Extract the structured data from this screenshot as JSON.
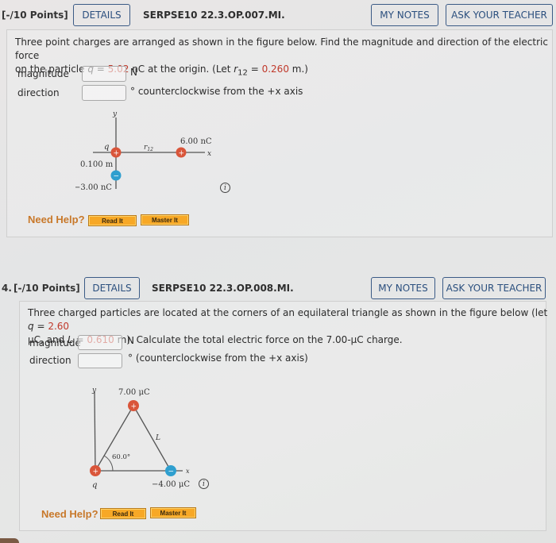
{
  "questions": [
    {
      "number": "",
      "points": "[-/10 Points]",
      "details_label": "DETAILS",
      "code": "SERPSE10 22.3.OP.007.MI.",
      "my_notes_label": "MY NOTES",
      "ask_teacher_label": "ASK YOUR TEACHER",
      "text_line1": "Three point charges are arranged as shown in the figure below. Find the magnitude and direction of the electric force",
      "text_line2_a": "on the particle ",
      "text_line2_var": "q",
      "text_line2_eq": " = ",
      "q_value": "5.02",
      "text_line2_b": " nC at the origin. (Let ",
      "r_var": "r",
      "r_sub": "12",
      "r_eq": " = ",
      "r_value": "0.260",
      "text_line2_c": " m.)",
      "magnitude_label": "magnitude",
      "magnitude_value": "",
      "magnitude_unit": "N",
      "direction_label": "direction",
      "direction_value": "",
      "direction_unit": "° counterclockwise from the +x axis",
      "figure": {
        "y_axis": "y",
        "x_axis": "x",
        "q_label": "q",
        "r12_label": "r",
        "r12_sub": "12",
        "charge_right": "6.00 nC",
        "distance_label": "0.100 m",
        "charge_below": "−3.00 nC",
        "plus_sign": "+",
        "minus_sign": "−",
        "info": "i"
      },
      "need_help": "Need Help?",
      "read_it": "Read It",
      "master_it": "Master It"
    },
    {
      "number": "4.",
      "points": "[-/10 Points]",
      "details_label": "DETAILS",
      "code": "SERPSE10 22.3.OP.008.MI.",
      "my_notes_label": "MY NOTES",
      "ask_teacher_label": "ASK YOUR TEACHER",
      "text_line1_a": "Three charged particles are located at the corners of an equilateral triangle as shown in the figure below (let ",
      "q_var": "q",
      "q_eq": " = ",
      "q_value": "2.60",
      "text_line2_a": "μC, and ",
      "l_var": "L",
      "l_eq": " = ",
      "l_value": "0.610",
      "text_line2_b": " m). Calculate the total electric force on the 7.00-μC charge.",
      "magnitude_label": "magnitude",
      "magnitude_value": "",
      "magnitude_unit": "N",
      "direction_label": "direction",
      "direction_value": "",
      "direction_unit": "° (counterclockwise from the +x axis)",
      "figure": {
        "y_axis": "y",
        "x_axis": "x",
        "top_charge": "7.00 μC",
        "side_label": "L",
        "angle_label": "60.0°",
        "q_label": "q",
        "right_charge": "−4.00 μC",
        "plus_sign": "+",
        "minus_sign": "−",
        "info": "i"
      },
      "need_help": "Need Help?",
      "read_it": "Read It",
      "master_it": "Master It"
    }
  ],
  "colors": {
    "positive_charge": "#d9553a",
    "negative_charge": "#2f9fcf",
    "button_border": "#3b5b86",
    "given_value": "#c0392b",
    "help_orange": "#f7a826"
  }
}
